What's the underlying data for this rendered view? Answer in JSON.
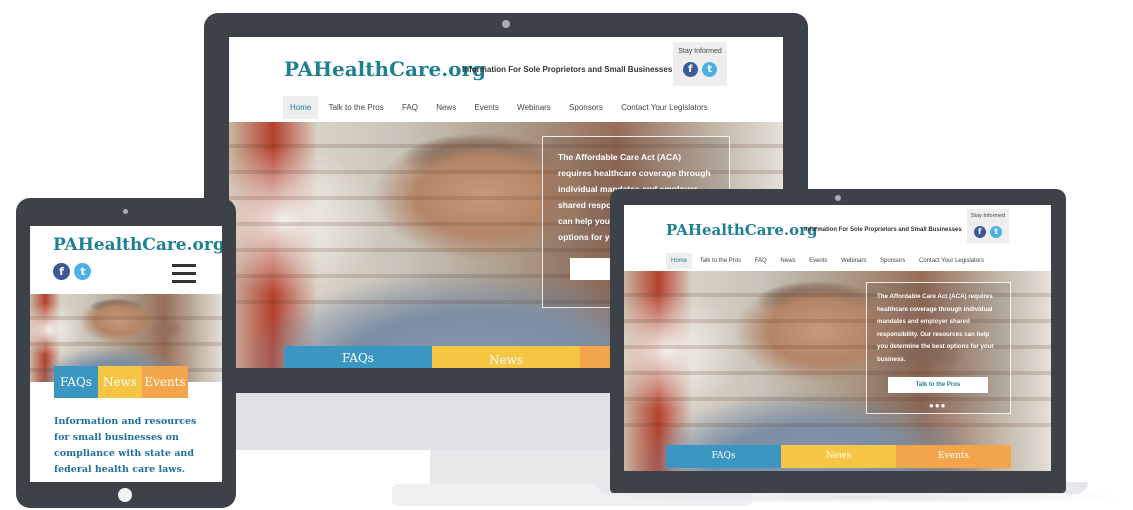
{
  "site": {
    "logo": "PAHealthCare.org",
    "tagline": "Information For Sole Proprietors and Small Businesses",
    "stay_informed": "Stay Informed",
    "facebook_glyph": "f",
    "twitter_glyph": "t",
    "nav": [
      "Home",
      "Talk to the Pros",
      "FAQ",
      "News",
      "Events",
      "Webinars",
      "Sponsors",
      "Contact Your Legislators"
    ],
    "hero_text": "The Affordable Care Act (ACA) requires healthcare coverage through individual mandates and employer shared responsibility. Our resources can help you determine the best options for your business.",
    "desktop_hero_visible": "The Affordable Care Act (ACA) requires healthcare coverage through individual mandates and employer shared responsibility. Our resources can help you determine the best options for your business.",
    "cta_label": "Talk to the Pros",
    "cta_partial": "T",
    "tiles": [
      "FAQs",
      "News",
      "Events"
    ],
    "mobile_intro": "Information and resources for small businesses on compliance with state and federal health care laws."
  },
  "colors": {
    "brand": "#1f7f93",
    "device_frame": "#3d4248",
    "faq_tile": "#3b97c1",
    "news_tile": "#f6c544",
    "events_tile": "#f3a54b",
    "facebook": "#3b5998",
    "twitter": "#4ab1e6"
  },
  "icons": {
    "facebook": "facebook-icon",
    "twitter": "twitter-icon",
    "menu": "hamburger-menu-icon",
    "camera": "camera-dot-icon",
    "home_button": "home-button-icon"
  }
}
